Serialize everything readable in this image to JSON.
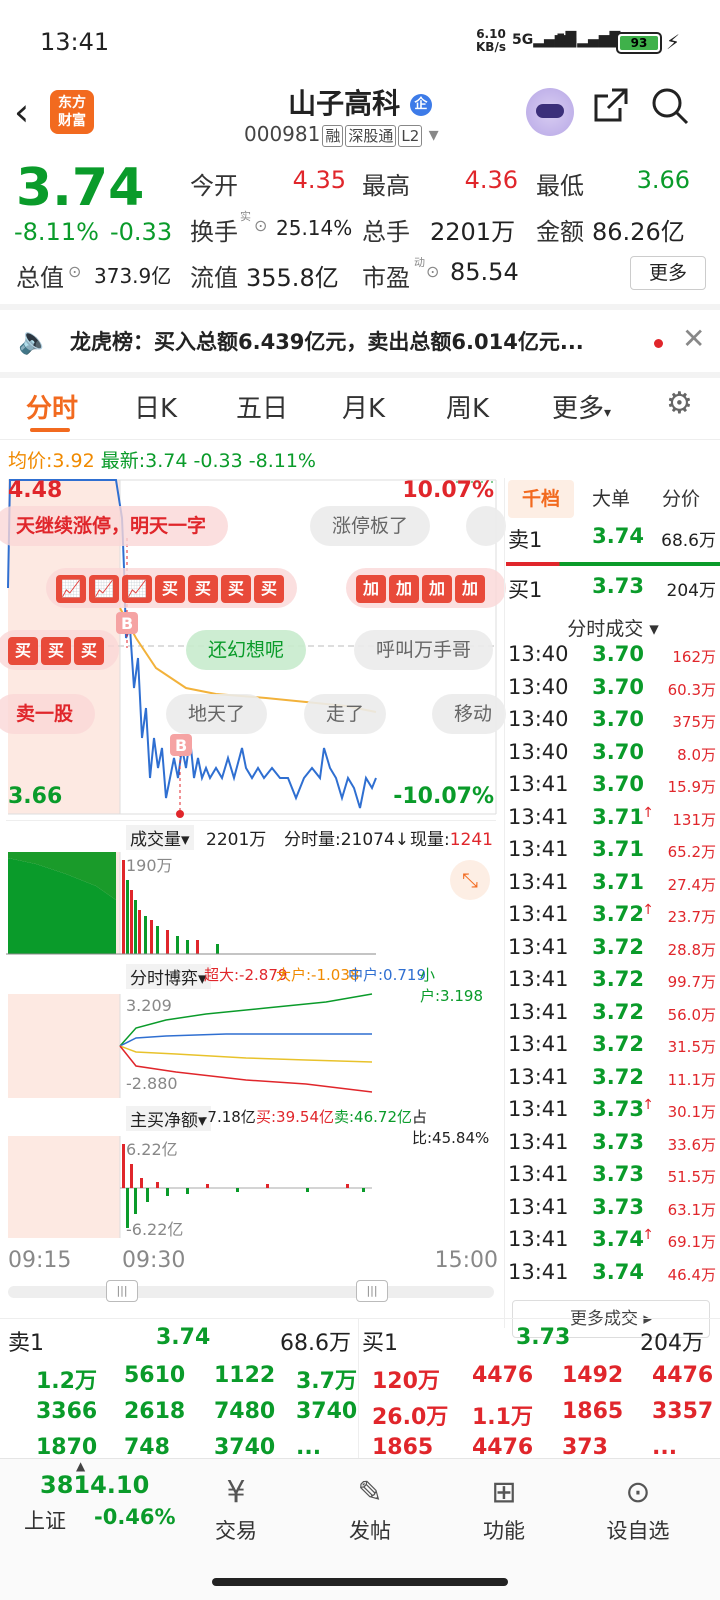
{
  "status_bar": {
    "time": "13:41",
    "net_speed": "6.10",
    "net_unit": "KB/s",
    "sig1": "5G",
    "sig2": "5G",
    "battery": "93"
  },
  "header": {
    "logo_line1": "东方",
    "logo_line2": "财富",
    "title": "山子高科",
    "badge": "企",
    "code": "000981",
    "tag1": "融",
    "tag2": "深股通",
    "tag3": "L2"
  },
  "quote": {
    "price": "3.74",
    "change_pct": "-8.11%",
    "change": "-0.33",
    "open_label": "今开",
    "open": "4.35",
    "high_label": "最高",
    "high": "4.36",
    "low_label": "最低",
    "low": "3.66",
    "turnover_label": "换手",
    "turnover": "25.14%",
    "vol_label": "总手",
    "vol": "2201万",
    "amount_label": "金额",
    "amount": "86.26亿",
    "mcap_label": "总值",
    "mcap": "373.9亿",
    "float_label": "流值",
    "float_cap": "355.8亿",
    "pe_label": "市盈",
    "pe": "85.54",
    "more": "更多"
  },
  "lhb": {
    "text": "龙虎榜：买入总额6.439亿元，卖出总额6.014亿元..."
  },
  "tabs": [
    "分时",
    "日K",
    "五日",
    "月K",
    "周K",
    "更多"
  ],
  "avg_line": {
    "avg_label": "均价:",
    "avg": "3.92",
    "latest_label": "最新:",
    "latest": "3.74",
    "chg": "-0.33",
    "pct": "-8.11%"
  },
  "chart_labels": {
    "top_price": "4.48",
    "bottom_price": "3.66",
    "top_pct": "10.07%",
    "bottom_pct": "-10.07%",
    "marker": "B"
  },
  "danmu": [
    {
      "text": "天继续涨停，明天一字",
      "style": "red"
    },
    {
      "text": "涨停板了",
      "style": "gray"
    },
    {
      "text": "还幻想呢",
      "style": "green"
    },
    {
      "text": "呼叫万手哥",
      "style": "gray"
    },
    {
      "text": "卖一股",
      "style": "red"
    },
    {
      "text": "地天了",
      "style": "gray"
    },
    {
      "text": "走了",
      "style": "gray"
    },
    {
      "text": "移动",
      "style": "gray"
    }
  ],
  "danmu_boxes": {
    "buy": "买",
    "add": "加"
  },
  "volume_panel": {
    "label": "成交量",
    "total": "2201万",
    "fsl": "分时量:21074↓",
    "now_label": "现量:",
    "now": "1241",
    "scale": "190万"
  },
  "game_panel": {
    "label": "分时博弈",
    "super": "超大:-2.879",
    "big": "大户:-1.038",
    "mid": "中户:0.719",
    "small": "小户:3.198",
    "max": "3.209",
    "min": "-2.880"
  },
  "net_panel": {
    "label": "主买净额",
    "net": "-7.18亿",
    "buy": "买:39.54亿",
    "sell": "卖:46.72亿",
    "ratio": "占比:45.84%",
    "max": "6.22亿",
    "min": "-6.22亿"
  },
  "time_axis": [
    "09:15",
    "09:30",
    "15:00"
  ],
  "right_panel": {
    "tabs": [
      "千档",
      "大单",
      "分价"
    ],
    "ask1": {
      "label": "卖1",
      "price": "3.74",
      "vol": "68.6万"
    },
    "bid1": {
      "label": "买1",
      "price": "3.73",
      "vol": "204万"
    },
    "ticks_title": "分时成交",
    "ticks": [
      {
        "t": "13:40",
        "p": "3.70",
        "v": "162万",
        "up": ""
      },
      {
        "t": "13:40",
        "p": "3.70",
        "v": "60.3万",
        "up": ""
      },
      {
        "t": "13:40",
        "p": "3.70",
        "v": "375万",
        "up": ""
      },
      {
        "t": "13:40",
        "p": "3.70",
        "v": "8.0万",
        "up": ""
      },
      {
        "t": "13:41",
        "p": "3.70",
        "v": "15.9万",
        "up": ""
      },
      {
        "t": "13:41",
        "p": "3.71",
        "v": "131万",
        "up": "↑"
      },
      {
        "t": "13:41",
        "p": "3.71",
        "v": "65.2万",
        "up": ""
      },
      {
        "t": "13:41",
        "p": "3.71",
        "v": "27.4万",
        "up": ""
      },
      {
        "t": "13:41",
        "p": "3.72",
        "v": "23.7万",
        "up": "↑"
      },
      {
        "t": "13:41",
        "p": "3.72",
        "v": "28.8万",
        "up": ""
      },
      {
        "t": "13:41",
        "p": "3.72",
        "v": "99.7万",
        "up": ""
      },
      {
        "t": "13:41",
        "p": "3.72",
        "v": "56.0万",
        "up": ""
      },
      {
        "t": "13:41",
        "p": "3.72",
        "v": "31.5万",
        "up": ""
      },
      {
        "t": "13:41",
        "p": "3.72",
        "v": "11.1万",
        "up": ""
      },
      {
        "t": "13:41",
        "p": "3.73",
        "v": "30.1万",
        "up": "↑"
      },
      {
        "t": "13:41",
        "p": "3.73",
        "v": "33.6万",
        "up": ""
      },
      {
        "t": "13:41",
        "p": "3.73",
        "v": "51.5万",
        "up": ""
      },
      {
        "t": "13:41",
        "p": "3.73",
        "v": "63.1万",
        "up": ""
      },
      {
        "t": "13:41",
        "p": "3.74",
        "v": "69.1万",
        "up": "↑"
      },
      {
        "t": "13:41",
        "p": "3.74",
        "v": "46.4万",
        "up": ""
      }
    ],
    "more_ticks": "更多成交"
  },
  "order_book": {
    "sell_label": "卖1",
    "sell_price": "3.74",
    "sell_vol": "68.6万",
    "buy_label": "买1",
    "buy_price": "3.73",
    "buy_vol": "204万",
    "sell_rows": [
      [
        "1.2万",
        "5610",
        "1122",
        "3.7万"
      ],
      [
        "3366",
        "2618",
        "7480",
        "3740"
      ],
      [
        "1870",
        "748",
        "3740",
        "..."
      ]
    ],
    "buy_rows": [
      [
        "120万",
        "4476",
        "1492",
        "4476"
      ],
      [
        "26.0万",
        "1.1万",
        "1865",
        "3357"
      ],
      [
        "1865",
        "4476",
        "373",
        "..."
      ]
    ]
  },
  "bottom_nav": {
    "index_value": "3814.10",
    "index_name": "上证",
    "index_pct": "-0.46%",
    "trade": "交易",
    "post": "发帖",
    "func": "功能",
    "watch": "设自选"
  }
}
